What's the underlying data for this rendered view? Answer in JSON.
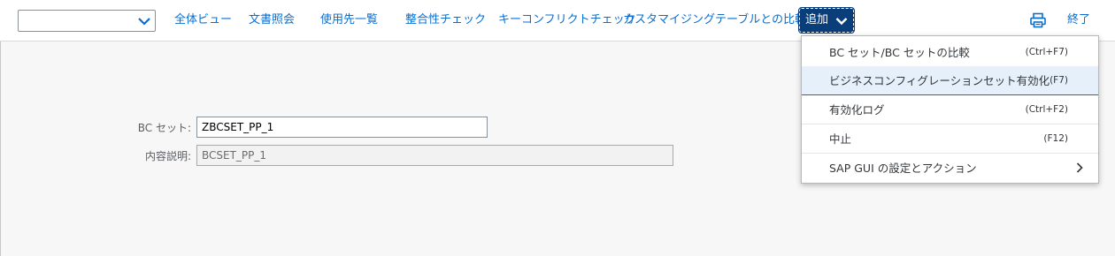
{
  "toolbar": {
    "combo_value": "",
    "items": [
      {
        "label": "全体ビュー"
      },
      {
        "label": "文書照会"
      },
      {
        "label": "使用先一覧"
      },
      {
        "label": "整合性チェック"
      },
      {
        "label": "キーコンフリクトチェック"
      },
      {
        "label": "カスタマイジングテーブルとの比較"
      }
    ],
    "add_label": "追加",
    "exit_label": "終了"
  },
  "form": {
    "bc_set_label": "BC セット:",
    "bc_set_value": "ZBCSET_PP_1",
    "description_label": "内容説明:",
    "description_value": "BCSET_PP_1"
  },
  "menu": {
    "items": [
      {
        "label": "BC セット/BC セットの比較",
        "shortcut": "(Ctrl+F7)"
      },
      {
        "label": "ビジネスコンフィグレーションセット有効化",
        "shortcut": "(F7)"
      },
      {
        "label": "有効化ログ",
        "shortcut": "(Ctrl+F2)"
      },
      {
        "label": "中止",
        "shortcut": "(F12)"
      },
      {
        "label": "SAP GUI の設定とアクション",
        "shortcut": ""
      }
    ]
  },
  "colors": {
    "link": "#0a6ed1",
    "add_button_bg": "#0a3e7a",
    "menu_highlight": "#e5f0fa"
  }
}
